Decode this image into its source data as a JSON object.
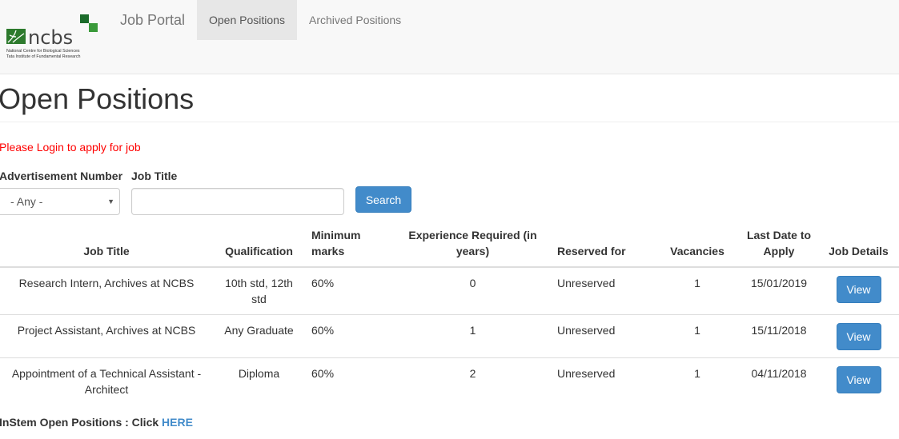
{
  "navbar": {
    "logo": {
      "name": "ncbs",
      "line1": "National Centre for Biological Sciences",
      "line2": "Tata Institute of Fundamental Research",
      "brand_color": "#2e7d32"
    },
    "brand": "Job Portal",
    "tabs": [
      {
        "label": "Open Positions",
        "active": true
      },
      {
        "label": "Archived Positions",
        "active": false
      }
    ]
  },
  "page": {
    "title": "Open Positions",
    "login_note": "Please Login to apply for job"
  },
  "filters": {
    "adv_label": "Advertisement Number",
    "adv_selected": "- Any -",
    "title_label": "Job Title",
    "title_value": "",
    "title_placeholder": "",
    "search_label": "Search"
  },
  "table": {
    "headers": [
      "Job Title",
      "Qualification",
      "Minimum marks",
      "Experience Required (in years)",
      "Reserved for",
      "Vacancies",
      "Last Date to Apply",
      "Job Details"
    ],
    "rows": [
      {
        "title": "Research Intern, Archives at NCBS",
        "qualification": "10th std, 12th std",
        "marks": "60%",
        "experience": "0",
        "reserved": "Unreserved",
        "vacancies": "1",
        "last_date": "15/01/2019",
        "action": "View"
      },
      {
        "title": "Project Assistant, Archives at NCBS",
        "qualification": "Any Graduate",
        "marks": "60%",
        "experience": "1",
        "reserved": "Unreserved",
        "vacancies": "1",
        "last_date": "15/11/2018",
        "action": "View"
      },
      {
        "title": "Appointment of a Technical Assistant - Architect",
        "qualification": "Diploma",
        "marks": "60%",
        "experience": "2",
        "reserved": "Unreserved",
        "vacancies": "1",
        "last_date": "04/11/2018",
        "action": "View"
      }
    ]
  },
  "footer": {
    "instem_text": "InStem Open Positions : Click ",
    "instem_link": "HERE"
  },
  "colors": {
    "primary": "#428bca",
    "alert": "#ff0000"
  }
}
